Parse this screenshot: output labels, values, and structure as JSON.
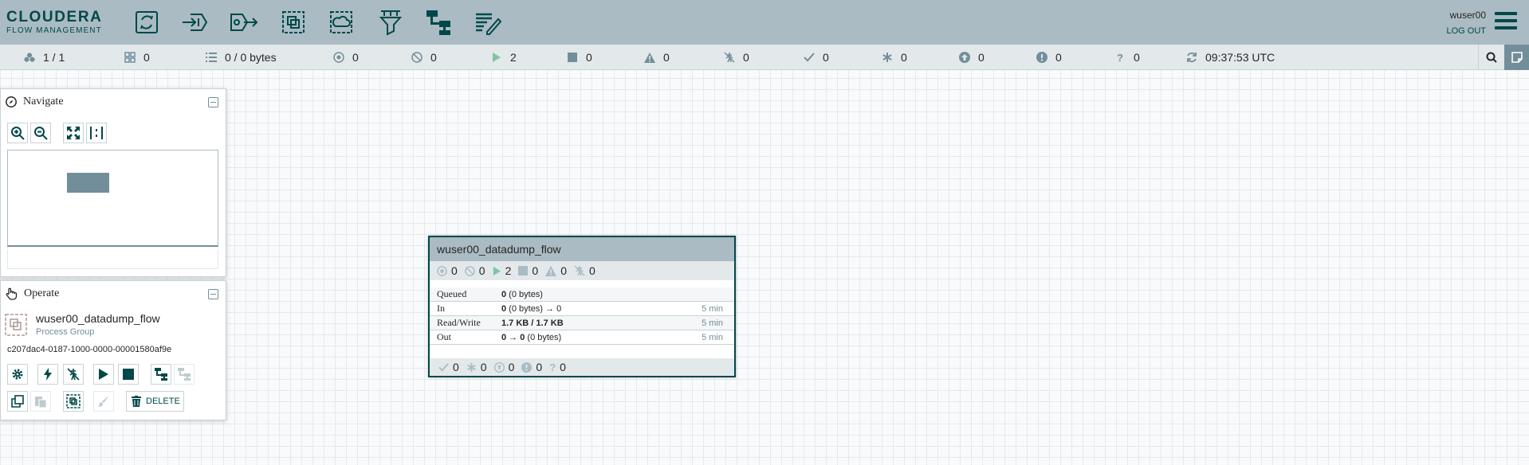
{
  "header": {
    "logo_line1": "CLOUDERA",
    "logo_line2": "FLOW MANAGEMENT",
    "components": [
      {
        "name": "processor",
        "icon": "processor-icon"
      },
      {
        "name": "input-port",
        "icon": "input-port-icon"
      },
      {
        "name": "output-port",
        "icon": "output-port-icon"
      },
      {
        "name": "process-group",
        "icon": "process-group-icon"
      },
      {
        "name": "remote-process-group",
        "icon": "remote-process-group-icon"
      },
      {
        "name": "funnel",
        "icon": "funnel-icon"
      },
      {
        "name": "template",
        "icon": "template-icon"
      },
      {
        "name": "label",
        "icon": "label-icon"
      }
    ],
    "user": "wuser00",
    "logout": "LOG OUT"
  },
  "status": {
    "cluster": "1 / 1",
    "threads": "0",
    "queued": "0 / 0 bytes",
    "transmitting": "0",
    "not_transmitting": "0",
    "running": "2",
    "stopped": "0",
    "invalid": "0",
    "disabled": "0",
    "up_to_date": "0",
    "locally_modified": "0",
    "stale": "0",
    "sync_failure": "0",
    "unknown": "0",
    "refreshed": "09:37:53 UTC"
  },
  "navigate": {
    "title": "Navigate"
  },
  "operate": {
    "title": "Operate",
    "name": "wuser00_datadump_flow",
    "type": "Process Group",
    "id": "c207dac4-0187-1000-0000-00001580af9e",
    "delete_label": "DELETE"
  },
  "process_group": {
    "name": "wuser00_datadump_flow",
    "counts": {
      "transmitting": "0",
      "not_transmitting": "0",
      "running": "2",
      "stopped": "0",
      "invalid": "0",
      "disabled": "0"
    },
    "stats": [
      {
        "label": "Queued",
        "value_bold": "0",
        "value_rest": " (0 bytes)",
        "time": ""
      },
      {
        "label": "In",
        "value_bold": "0",
        "value_rest": " (0 bytes) → 0",
        "time": "5 min"
      },
      {
        "label": "Read/Write",
        "value_bold": "1.7 KB / 1.7 KB",
        "value_rest": "",
        "time": "5 min"
      },
      {
        "label": "Out",
        "value_bold": "0 → 0",
        "value_rest": " (0 bytes)",
        "time": "5 min"
      }
    ],
    "footer": {
      "up_to_date": "0",
      "locally_modified": "0",
      "stale": "0",
      "sync_failure": "0",
      "unknown": "0"
    }
  },
  "colors": {
    "header_bg": "#aabbc3",
    "brand": "#004849",
    "running": "#7dc7a0",
    "icon_gray": "#728e9b",
    "birdseye_viewport": "#728e9b"
  }
}
